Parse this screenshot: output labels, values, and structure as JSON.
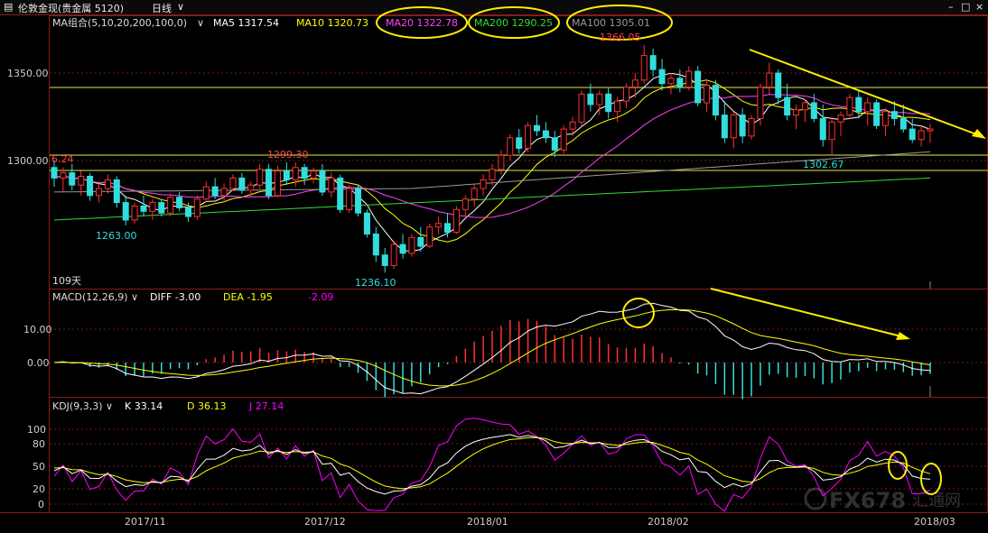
{
  "window": {
    "instrument": "伦敦金现(贵金属 5120)",
    "period": "日线",
    "period_arrow": "∨",
    "controls": [
      "–",
      "□",
      "×"
    ]
  },
  "main_panel": {
    "ma_group_label": "MA组合(5,10,20,200,100,0)",
    "ma_values": [
      {
        "name": "MA5",
        "value": "1317.54",
        "color": "#ffffff"
      },
      {
        "name": "MA10",
        "value": "1320.73",
        "color": "#ffff00"
      },
      {
        "name": "MA20",
        "value": "1322.78",
        "color": "#ff44ff",
        "circled": true
      },
      {
        "name": "MA200",
        "value": "1290.25",
        "color": "#33dd33",
        "circled": true
      },
      {
        "name": "MA100",
        "value": "1305.01",
        "color": "#999999",
        "circled": true
      }
    ],
    "price_ticks": [
      "1350.00",
      "1300.00"
    ],
    "annotations": [
      {
        "text": "1366.05",
        "color": "#ff4444"
      },
      {
        "text": "1299.30",
        "color": "#ff4444"
      },
      {
        "text": "6.24",
        "color": "#ff4444"
      },
      {
        "text": "1263.00",
        "color": "#33dddd"
      },
      {
        "text": "1236.10",
        "color": "#33dddd"
      },
      {
        "text": "1302.67",
        "color": "#33dddd"
      }
    ],
    "days_label": "109天"
  },
  "macd_panel": {
    "label": "MACD(12,26,9)",
    "diff_label": "DIFF",
    "diff_value": "-3.00",
    "dea_label": "DEA",
    "dea_value": "-1.95",
    "macd_value": "-2.09",
    "ticks": [
      "10.00",
      "0.00"
    ]
  },
  "kdj_panel": {
    "label": "KDJ(9,3,3)",
    "k_label": "K",
    "k_value": "33.14",
    "d_label": "D",
    "d_value": "36.13",
    "j_label": "J",
    "j_value": "27.14",
    "ticks": [
      "100",
      "80",
      "50",
      "20",
      "0"
    ]
  },
  "x_axis": [
    "2017/11",
    "2017/12",
    "2018/01",
    "2018/02",
    "2018/03"
  ],
  "watermark": "FX678",
  "watermark_sub": "汇通网",
  "chart_data": {
    "type": "candlestick",
    "title": "伦敦金现 日线",
    "ylim": [
      1225,
      1375
    ],
    "candles": [
      [
        1296,
        1300,
        1285,
        1290
      ],
      [
        1290,
        1296,
        1282,
        1293
      ],
      [
        1293,
        1298,
        1283,
        1286
      ],
      [
        1286,
        1294,
        1280,
        1291
      ],
      [
        1291,
        1293,
        1277,
        1280
      ],
      [
        1280,
        1288,
        1276,
        1284
      ],
      [
        1284,
        1292,
        1281,
        1289
      ],
      [
        1289,
        1291,
        1273,
        1276
      ],
      [
        1276,
        1280,
        1263,
        1266
      ],
      [
        1266,
        1276,
        1264,
        1274
      ],
      [
        1274,
        1280,
        1268,
        1271
      ],
      [
        1271,
        1278,
        1266,
        1276
      ],
      [
        1276,
        1278,
        1268,
        1270
      ],
      [
        1270,
        1281,
        1268,
        1279
      ],
      [
        1279,
        1282,
        1271,
        1273
      ],
      [
        1273,
        1276,
        1265,
        1268
      ],
      [
        1268,
        1280,
        1266,
        1278
      ],
      [
        1278,
        1288,
        1276,
        1285
      ],
      [
        1285,
        1290,
        1278,
        1280
      ],
      [
        1280,
        1287,
        1277,
        1284
      ],
      [
        1284,
        1292,
        1283,
        1290
      ],
      [
        1290,
        1293,
        1281,
        1283
      ],
      [
        1283,
        1288,
        1279,
        1286
      ],
      [
        1286,
        1298,
        1284,
        1295
      ],
      [
        1295,
        1298,
        1278,
        1280
      ],
      [
        1280,
        1297,
        1279,
        1294
      ],
      [
        1294,
        1299,
        1286,
        1289
      ],
      [
        1289,
        1299,
        1285,
        1296
      ],
      [
        1296,
        1298,
        1286,
        1290
      ],
      [
        1290,
        1296,
        1287,
        1294
      ],
      [
        1294,
        1298,
        1280,
        1282
      ],
      [
        1282,
        1293,
        1279,
        1290
      ],
      [
        1290,
        1292,
        1270,
        1272
      ],
      [
        1272,
        1286,
        1270,
        1284
      ],
      [
        1284,
        1286,
        1268,
        1270
      ],
      [
        1270,
        1272,
        1256,
        1258
      ],
      [
        1258,
        1262,
        1242,
        1246
      ],
      [
        1246,
        1250,
        1236,
        1240
      ],
      [
        1240,
        1254,
        1238,
        1252
      ],
      [
        1252,
        1258,
        1244,
        1247
      ],
      [
        1247,
        1258,
        1245,
        1256
      ],
      [
        1256,
        1262,
        1248,
        1251
      ],
      [
        1251,
        1264,
        1250,
        1262
      ],
      [
        1262,
        1268,
        1258,
        1264
      ],
      [
        1264,
        1270,
        1256,
        1259
      ],
      [
        1259,
        1274,
        1258,
        1272
      ],
      [
        1272,
        1280,
        1268,
        1278
      ],
      [
        1278,
        1286,
        1274,
        1284
      ],
      [
        1284,
        1292,
        1280,
        1289
      ],
      [
        1289,
        1298,
        1286,
        1295
      ],
      [
        1295,
        1306,
        1292,
        1303
      ],
      [
        1303,
        1315,
        1300,
        1313
      ],
      [
        1313,
        1318,
        1304,
        1307
      ],
      [
        1307,
        1322,
        1305,
        1320
      ],
      [
        1320,
        1326,
        1314,
        1317
      ],
      [
        1317,
        1322,
        1310,
        1313
      ],
      [
        1313,
        1317,
        1302,
        1306
      ],
      [
        1306,
        1320,
        1304,
        1318
      ],
      [
        1318,
        1325,
        1314,
        1322
      ],
      [
        1322,
        1340,
        1320,
        1338
      ],
      [
        1338,
        1344,
        1328,
        1332
      ],
      [
        1332,
        1340,
        1326,
        1338
      ],
      [
        1338,
        1342,
        1324,
        1328
      ],
      [
        1328,
        1336,
        1322,
        1334
      ],
      [
        1334,
        1344,
        1330,
        1342
      ],
      [
        1342,
        1350,
        1336,
        1346
      ],
      [
        1346,
        1366,
        1344,
        1360
      ],
      [
        1360,
        1364,
        1348,
        1352
      ],
      [
        1352,
        1358,
        1340,
        1344
      ],
      [
        1344,
        1350,
        1338,
        1347
      ],
      [
        1347,
        1352,
        1339,
        1342
      ],
      [
        1342,
        1354,
        1340,
        1351
      ],
      [
        1351,
        1354,
        1331,
        1333
      ],
      [
        1333,
        1346,
        1328,
        1343
      ],
      [
        1343,
        1346,
        1323,
        1326
      ],
      [
        1326,
        1334,
        1310,
        1313
      ],
      [
        1313,
        1328,
        1307,
        1326
      ],
      [
        1326,
        1330,
        1310,
        1314
      ],
      [
        1314,
        1326,
        1312,
        1324
      ],
      [
        1324,
        1344,
        1320,
        1342
      ],
      [
        1342,
        1356,
        1338,
        1350
      ],
      [
        1350,
        1352,
        1332,
        1336
      ],
      [
        1336,
        1344,
        1323,
        1326
      ],
      [
        1326,
        1332,
        1318,
        1329
      ],
      [
        1329,
        1335,
        1322,
        1333
      ],
      [
        1333,
        1338,
        1322,
        1324
      ],
      [
        1324,
        1332,
        1308,
        1312
      ],
      [
        1312,
        1325,
        1303,
        1322
      ],
      [
        1322,
        1328,
        1314,
        1326
      ],
      [
        1326,
        1338,
        1324,
        1336
      ],
      [
        1336,
        1340,
        1324,
        1328
      ],
      [
        1328,
        1336,
        1320,
        1333
      ],
      [
        1333,
        1335,
        1318,
        1320
      ],
      [
        1320,
        1330,
        1314,
        1328
      ],
      [
        1328,
        1334,
        1320,
        1324
      ],
      [
        1324,
        1332,
        1316,
        1318
      ],
      [
        1318,
        1324,
        1310,
        1312
      ],
      [
        1312,
        1320,
        1308,
        1317
      ],
      [
        1317,
        1321,
        1310,
        1318
      ]
    ],
    "series": [
      {
        "name": "MA5",
        "color": "#ffffff"
      },
      {
        "name": "MA10",
        "color": "#ffff00"
      },
      {
        "name": "MA20",
        "color": "#ff44ff"
      },
      {
        "name": "MA200",
        "color": "#33dd33"
      },
      {
        "name": "MA100",
        "color": "#999999"
      }
    ]
  }
}
